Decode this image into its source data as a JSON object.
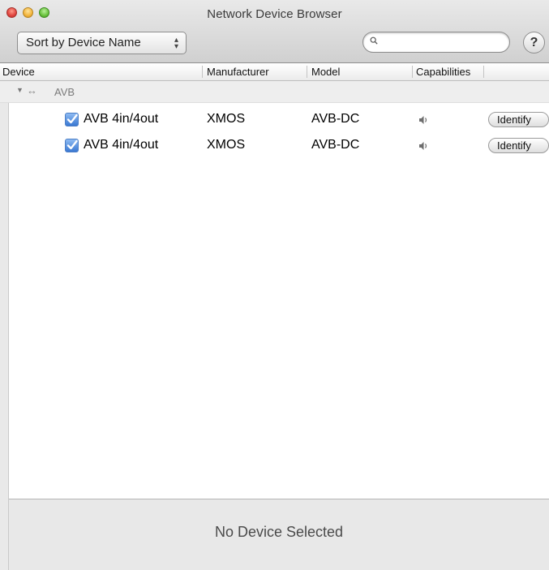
{
  "window": {
    "title": "Network Device Browser"
  },
  "toolbar": {
    "sort_label": "Sort by Device Name",
    "search_placeholder": "",
    "help_label": "?"
  },
  "table": {
    "columns": [
      "Device",
      "Manufacturer",
      "Model",
      "Capabilities"
    ],
    "groups": [
      {
        "name": "AVB",
        "expanded": true,
        "rows": [
          {
            "checked": true,
            "device": "AVB 4in/4out",
            "manufacturer": "XMOS",
            "model": "AVB-DC",
            "capability_icon": "speaker-icon",
            "action": "Identify"
          },
          {
            "checked": true,
            "device": "AVB 4in/4out",
            "manufacturer": "XMOS",
            "model": "AVB-DC",
            "capability_icon": "speaker-icon",
            "action": "Identify"
          }
        ]
      }
    ]
  },
  "detail": {
    "status": "No Device Selected"
  },
  "colors": {
    "checkbox_accent": "#3a78d2",
    "close": "#e0443e",
    "minimize": "#f2b43c",
    "zoom": "#69c23d"
  }
}
